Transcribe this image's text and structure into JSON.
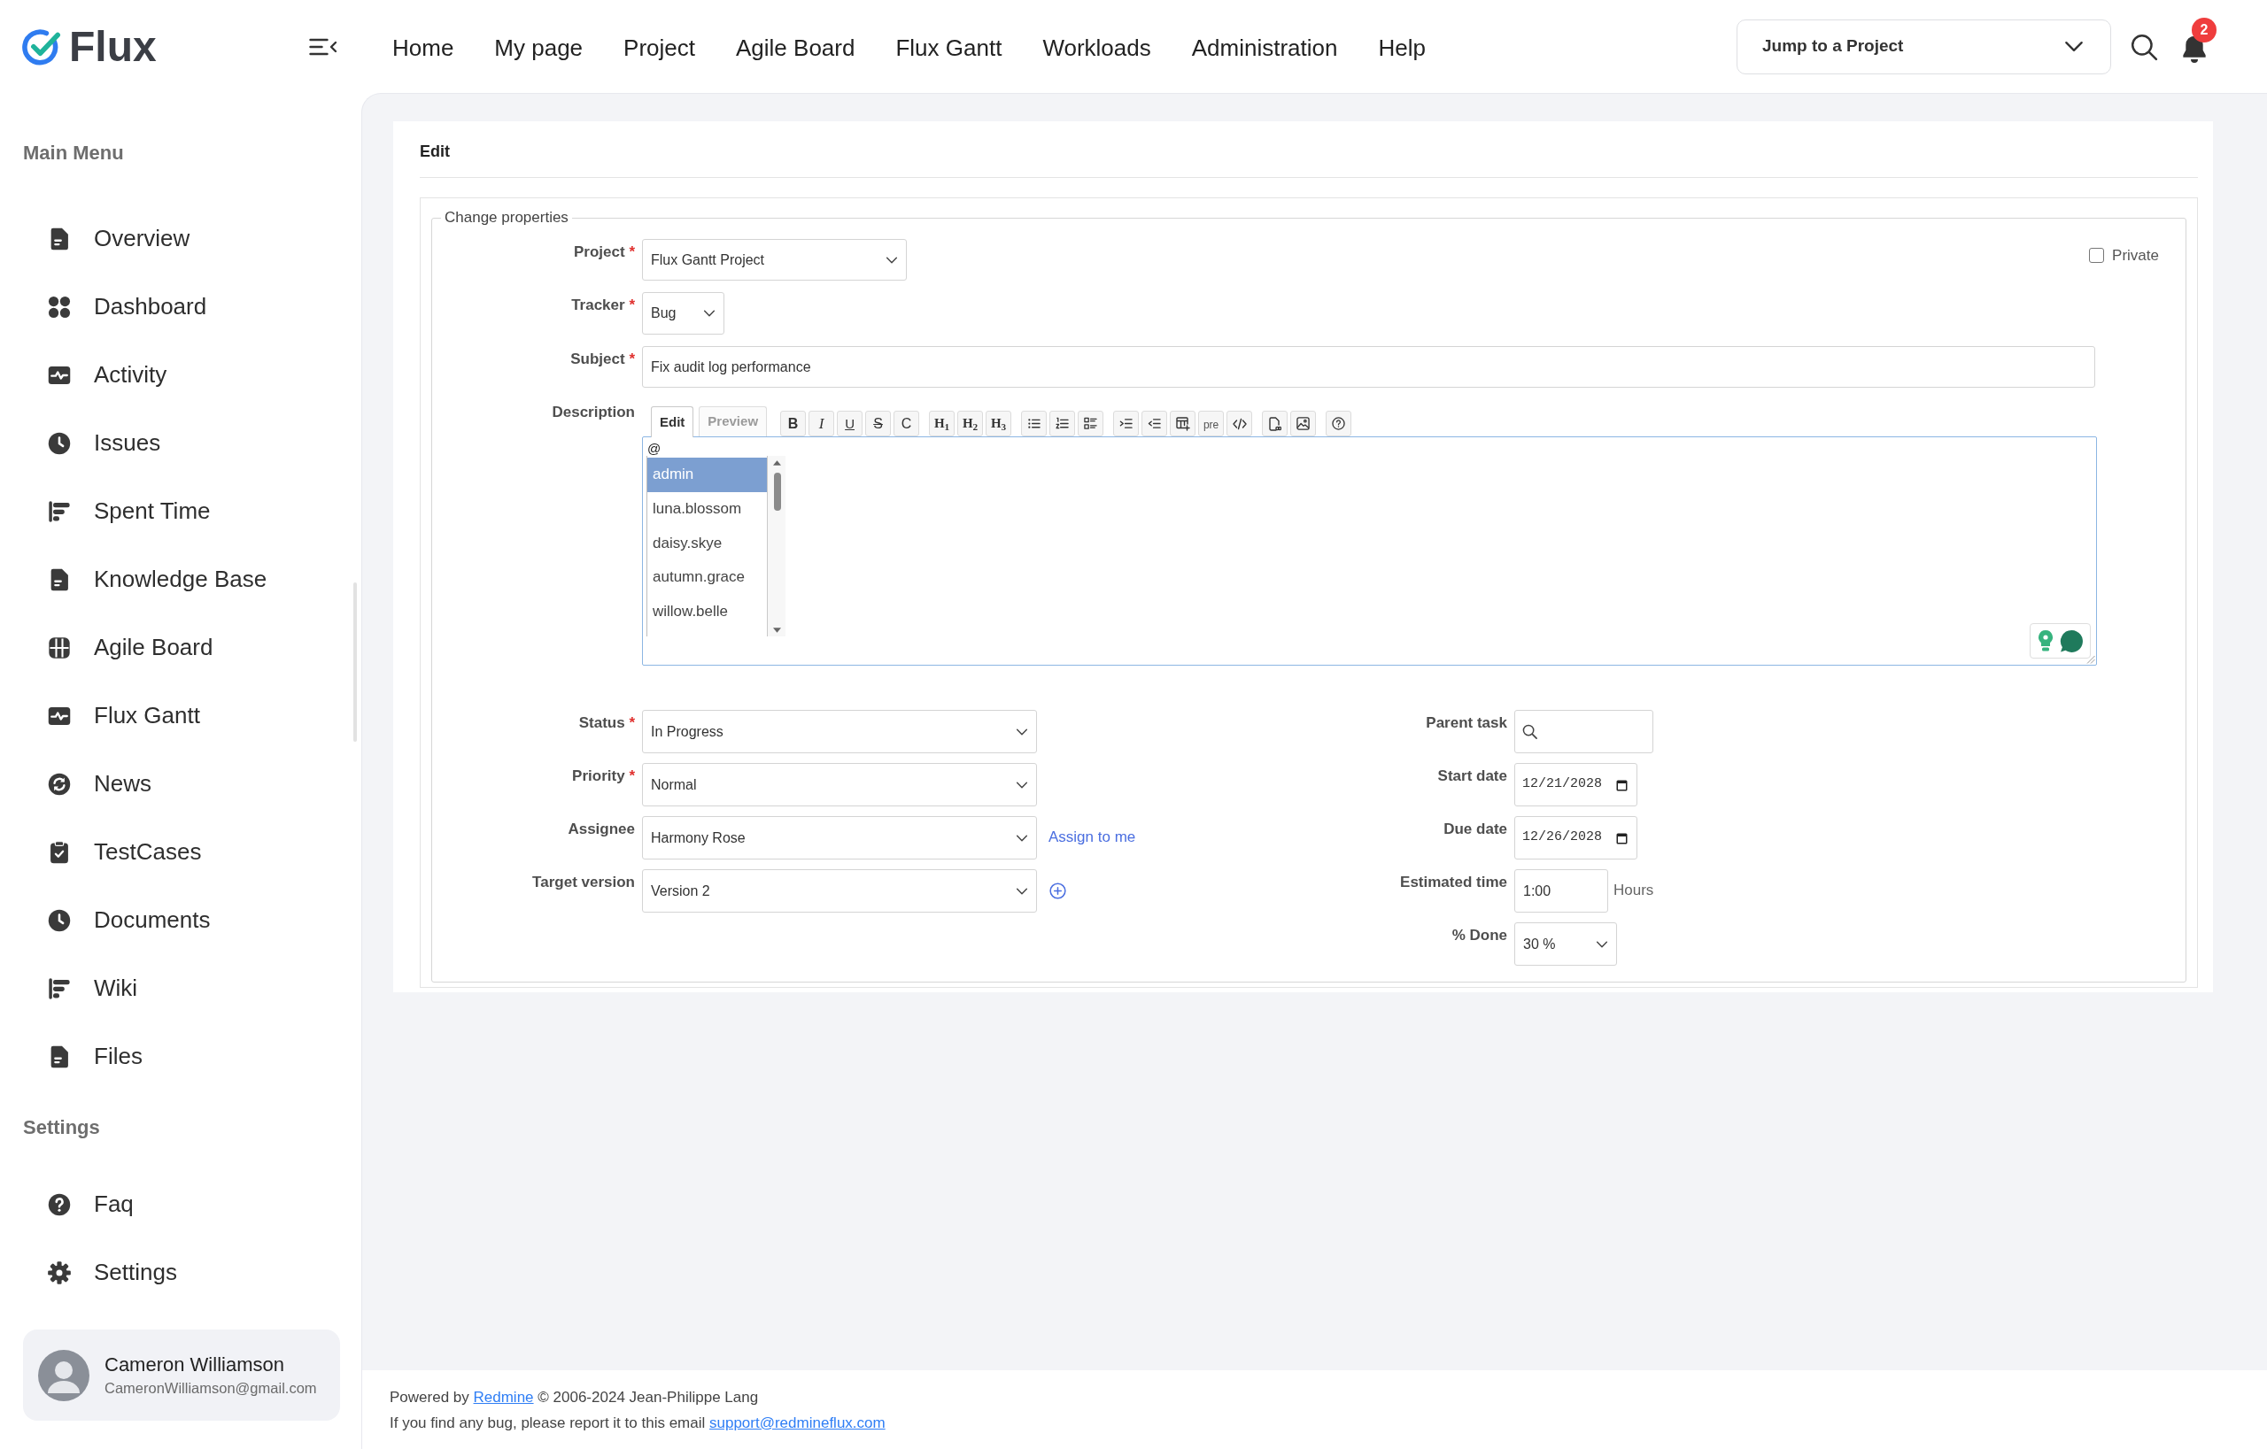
{
  "header": {
    "logo": "Flux",
    "nav": [
      "Home",
      "My page",
      "Project",
      "Agile Board",
      "Flux Gantt",
      "Workloads",
      "Administration",
      "Help"
    ],
    "project_jump": {
      "label": "Jump to a Project"
    },
    "notifications": {
      "count": "2"
    }
  },
  "sidebar": {
    "sections": [
      {
        "title": "Main Menu",
        "items": [
          "Overview",
          "Dashboard",
          "Activity",
          "Issues",
          "Spent Time",
          "Knowledge Base",
          "Agile Board",
          "Flux Gantt",
          "News",
          "TestCases",
          "Documents",
          "Wiki",
          "Files"
        ]
      },
      {
        "title": "Settings",
        "items": [
          "Faq",
          "Settings"
        ]
      }
    ],
    "user": {
      "name": "Cameron Williamson",
      "email": "CameronWilliamson@gmail.com"
    }
  },
  "issue_form": {
    "title": "Edit",
    "legend": "Change properties",
    "private": {
      "label": "Private",
      "checked": false
    },
    "top_fields": [
      {
        "label": "Project",
        "required_mark": "*",
        "kind": "select",
        "value": "Flux Gantt Project"
      },
      {
        "label": "Tracker",
        "required_mark": "*",
        "kind": "select",
        "value": "Bug"
      },
      {
        "label": "Subject",
        "required_mark": "*",
        "kind": "text",
        "value": "Fix audit log performance"
      }
    ],
    "description": {
      "label": "Description",
      "tabs": [
        {
          "label": "Edit",
          "selected": true
        },
        {
          "label": "Preview",
          "selected": false
        }
      ],
      "toolbar": [
        [
          {
            "kind": "bold",
            "label": "B"
          },
          {
            "kind": "italic",
            "label": "I"
          },
          {
            "kind": "underline",
            "label": "U"
          },
          {
            "kind": "strike",
            "label": "S"
          },
          {
            "kind": "code",
            "label": "C"
          }
        ],
        [
          {
            "kind": "heading",
            "label": "H$_{1}$"
          },
          {
            "kind": "heading",
            "label": "H$_{2}$"
          },
          {
            "kind": "heading",
            "label": "H$_{3}$"
          }
        ],
        [
          {
            "kind": "bullets"
          },
          {
            "kind": "numbers"
          },
          {
            "kind": "tasks"
          }
        ],
        [
          {
            "kind": "indent"
          },
          {
            "kind": "outdent"
          },
          {
            "kind": "table"
          },
          {
            "kind": "pre",
            "label": "pre"
          },
          {
            "kind": "code-block"
          }
        ],
        [
          {
            "kind": "attachment"
          },
          {
            "kind": "image"
          }
        ],
        [
          {
            "kind": "help"
          }
        ]
      ],
      "value": "@",
      "mentions": [
        {
          "label": "admin",
          "selected": true
        },
        {
          "label": "luna.blossom",
          "selected": false
        },
        {
          "label": "daisy.skye",
          "selected": false
        },
        {
          "label": "autumn.grace",
          "selected": false
        },
        {
          "label": "willow.belle",
          "selected": false
        }
      ]
    },
    "left_fields": [
      {
        "label": "Status",
        "required_mark": "*",
        "kind": "select",
        "value": "In Progress"
      },
      {
        "label": "Priority",
        "required_mark": "*",
        "kind": "select",
        "value": "Normal"
      },
      {
        "label": "Assignee",
        "kind": "select",
        "value": "Harmony Rose",
        "link": "Assign to me"
      },
      {
        "label": "Target version",
        "kind": "select",
        "value": "Version 2",
        "add": true
      }
    ],
    "right_fields": [
      {
        "label": "Parent task",
        "kind": "search"
      },
      {
        "label": "Start date",
        "kind": "date",
        "value": "12/21/2028"
      },
      {
        "label": "Due date",
        "kind": "date",
        "value": "12/26/2028"
      },
      {
        "label": "Estimated time",
        "kind": "text",
        "value": "1:00",
        "unit": "Hours"
      },
      {
        "label": "% Done",
        "kind": "select",
        "value": "30 %"
      }
    ]
  },
  "footer": {
    "lines": [
      [
        {
          "kind": "text",
          "text": "Powered by"
        },
        {
          "kind": "link",
          "text": "Redmine"
        },
        {
          "kind": "text",
          "text": "© 2006-2024 Jean-Philippe Lang"
        }
      ],
      [
        {
          "kind": "text",
          "text": "If you find any bug, please report it to this email"
        },
        {
          "kind": "link",
          "text": "support@redmineflux.com"
        }
      ]
    ]
  }
}
